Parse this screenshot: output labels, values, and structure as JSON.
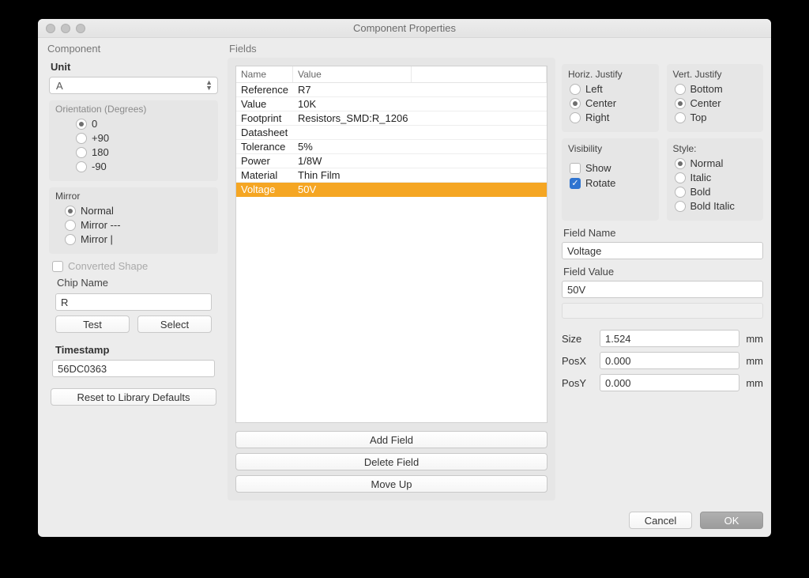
{
  "window": {
    "title": "Component Properties"
  },
  "sections": {
    "component": "Component",
    "fields": "Fields"
  },
  "unit": {
    "label": "Unit",
    "value": "A"
  },
  "orientation": {
    "title": "Orientation (Degrees)",
    "options": [
      "0",
      "+90",
      "180",
      "-90"
    ],
    "selected": "0"
  },
  "mirror": {
    "title": "Mirror",
    "options": [
      "Normal",
      "Mirror ---",
      "Mirror |"
    ],
    "selected": "Normal"
  },
  "converted_shape": {
    "label": "Converted Shape",
    "checked": false
  },
  "chip": {
    "label": "Chip Name",
    "value": "R",
    "test_label": "Test",
    "select_label": "Select"
  },
  "timestamp": {
    "label": "Timestamp",
    "value": "56DC0363"
  },
  "reset_label": "Reset to Library Defaults",
  "fields_table": {
    "headers": {
      "name": "Name",
      "value": "Value"
    },
    "rows": [
      {
        "name": "Reference",
        "value": "R7"
      },
      {
        "name": "Value",
        "value": "10K"
      },
      {
        "name": "Footprint",
        "value": "Resistors_SMD:R_1206"
      },
      {
        "name": "Datasheet",
        "value": ""
      },
      {
        "name": "Tolerance",
        "value": "5%"
      },
      {
        "name": "Power",
        "value": "1/8W"
      },
      {
        "name": "Material",
        "value": "Thin Film"
      },
      {
        "name": "Voltage",
        "value": "50V"
      }
    ],
    "selected_index": 7
  },
  "mid_buttons": {
    "add": "Add Field",
    "delete": "Delete Field",
    "moveup": "Move Up"
  },
  "horiz_justify": {
    "title": "Horiz. Justify",
    "options": [
      "Left",
      "Center",
      "Right"
    ],
    "selected": "Center"
  },
  "vert_justify": {
    "title": "Vert. Justify",
    "options": [
      "Bottom",
      "Center",
      "Top"
    ],
    "selected": "Center"
  },
  "visibility": {
    "title": "Visibility",
    "show_label": "Show",
    "show": false,
    "rotate_label": "Rotate",
    "rotate": true
  },
  "style": {
    "title": "Style:",
    "options": [
      "Normal",
      "Italic",
      "Bold",
      "Bold Italic"
    ],
    "selected": "Normal"
  },
  "field_name": {
    "label": "Field Name",
    "value": "Voltage"
  },
  "field_value": {
    "label": "Field Value",
    "value": "50V"
  },
  "size": {
    "label": "Size",
    "value": "1.524",
    "unit": "mm"
  },
  "posx": {
    "label": "PosX",
    "value": "0.000",
    "unit": "mm"
  },
  "posy": {
    "label": "PosY",
    "value": "0.000",
    "unit": "mm"
  },
  "footer": {
    "cancel": "Cancel",
    "ok": "OK"
  }
}
